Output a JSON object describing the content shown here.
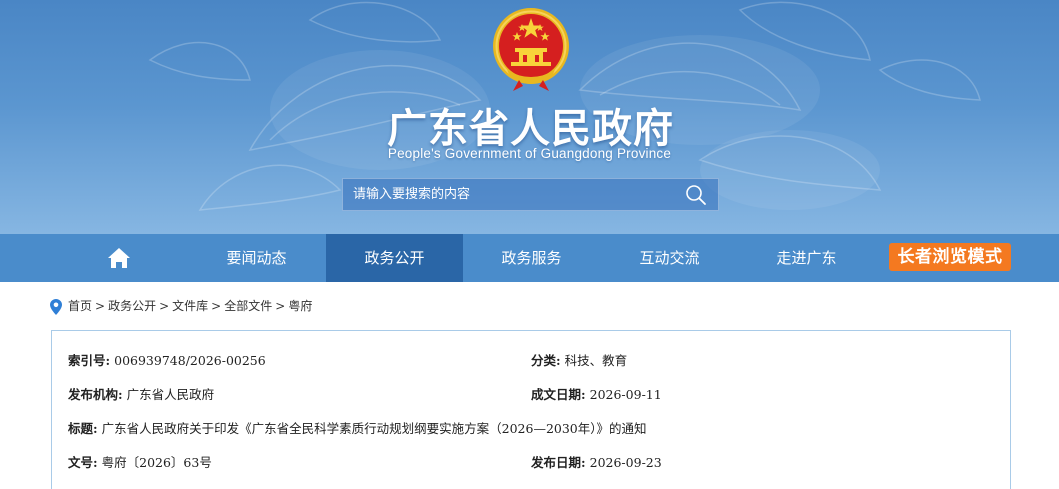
{
  "header": {
    "title": "广东省人民政府",
    "subtitle": "People's Government of Guangdong Province",
    "search_placeholder": "请输入要搜索的内容"
  },
  "nav": {
    "home_icon": "home-icon",
    "items": [
      {
        "label": "要闻动态",
        "active": false
      },
      {
        "label": "政务公开",
        "active": true
      },
      {
        "label": "政务服务",
        "active": false
      },
      {
        "label": "互动交流",
        "active": false
      },
      {
        "label": "走进广东",
        "active": false
      }
    ],
    "elder_mode_label": "长者浏览模式"
  },
  "breadcrumb": {
    "icon": "location-pin-icon",
    "items": [
      "首页",
      "政务公开",
      "文件库",
      "全部文件",
      "粤府"
    ],
    "separator": ">"
  },
  "meta": {
    "index_no": {
      "label": "索引号:",
      "value": "006939748/2026-00256"
    },
    "category": {
      "label": "分类:",
      "value": "科技、教育"
    },
    "publisher": {
      "label": "发布机构:",
      "value": "广东省人民政府"
    },
    "date_written": {
      "label": "成文日期:",
      "value": "2026-09-11"
    },
    "title": {
      "label": "标题:",
      "value": "广东省人民政府关于印发《广东省全民科学素质行动规划纲要实施方案（2026—2030年）》的通知"
    },
    "doc_no": {
      "label": "文号:",
      "value": "粤府〔2026〕63号"
    },
    "date_published": {
      "label": "发布日期:",
      "value": "2026-09-23"
    }
  },
  "colors": {
    "banner_top": "#4a86c5",
    "banner_bottom": "#86b6e2",
    "nav_bg": "#4a8ccb",
    "nav_active": "#2a66a7",
    "elder_button": "#f47920",
    "meta_border": "#a9cbe8"
  }
}
